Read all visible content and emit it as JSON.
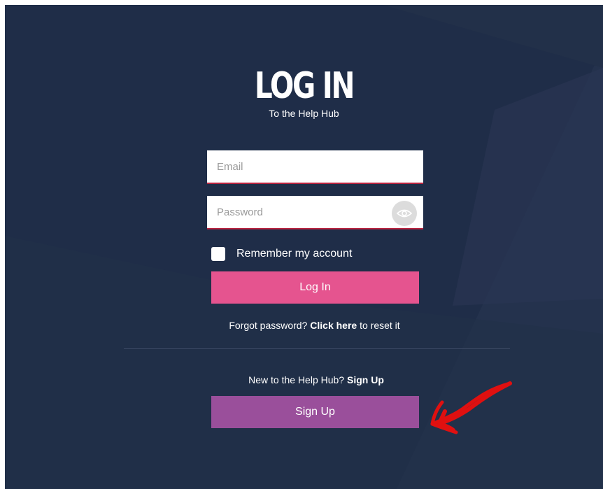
{
  "header": {
    "title": "LOG IN",
    "subtitle": "To the Help Hub"
  },
  "form": {
    "email_placeholder": "Email",
    "email_value": "",
    "password_placeholder": "Password",
    "password_value": "",
    "show_password_icon": "eye-icon",
    "remember_label": "Remember my account",
    "remember_checked": false,
    "login_label": "Log In"
  },
  "forgot": {
    "prefix": "Forgot password?",
    "link": "Click here",
    "suffix": "to reset it"
  },
  "signup": {
    "prompt": "New to the Help Hub?",
    "link": "Sign Up",
    "button_label": "Sign Up"
  },
  "annotation": {
    "arrow_icon": "hand-drawn-arrow",
    "arrow_color": "#e01010"
  },
  "colors": {
    "background": "#1f2d48",
    "login_button": "#e5548f",
    "signup_button": "#9a4f9b",
    "input_border": "#b8233f"
  }
}
